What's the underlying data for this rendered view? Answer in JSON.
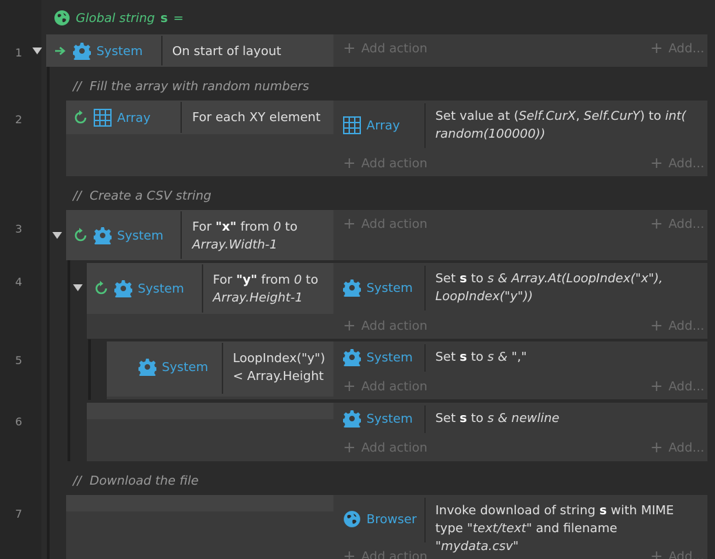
{
  "global": {
    "prefix": "Global string",
    "var": "s",
    "eq": "="
  },
  "add_action": "Add action",
  "add_short": "Add...",
  "comment_marker": "//",
  "lines": [
    "1",
    "2",
    "3",
    "4",
    "5",
    "6",
    "7"
  ],
  "events": {
    "e1": {
      "obj": "System",
      "cond": "On start of layout"
    },
    "c1": "Fill the array with random numbers",
    "e2": {
      "obj": "Array",
      "cond": "For each XY element",
      "act_obj": "Array",
      "act": {
        "p1": "Set value at (",
        "p2": "Self.CurX",
        "p3": ", ",
        "p4": "Self.CurY",
        "p5": ") to ",
        "p6": "int(",
        "p7": "random(100000))"
      }
    },
    "c2": "Create a CSV string",
    "e3": {
      "obj": "System",
      "c_for": "For",
      "c_var": "\"x\"",
      "c_from": "from",
      "c_zero": "0",
      "c_to": "to",
      "c_end": "Array.Width-1"
    },
    "e4": {
      "obj": "System",
      "c_for": "For",
      "c_var": "\"y\"",
      "c_from": "from",
      "c_zero": "0",
      "c_to": "to",
      "c_end": "Array.Height-1",
      "act_obj": "System",
      "act": {
        "p1": "Set",
        "p2": "s",
        "p3": "to",
        "p4": "s & Array.At(LoopIndex(\"x\"),",
        "p5": "LoopIndex(\"y\"))"
      }
    },
    "e5": {
      "obj": "System",
      "cond_l1": "LoopIndex(\"y\")",
      "cond_l2": "< Array.Height",
      "act_obj": "System",
      "act": {
        "p1": "Set",
        "p2": "s",
        "p3": "to",
        "p4": "s &",
        "p5": "\",\""
      }
    },
    "e6": {
      "act_obj": "System",
      "act": {
        "p1": "Set",
        "p2": "s",
        "p3": "to",
        "p4": "s & newline"
      }
    },
    "c3": "Download the file",
    "e7": {
      "act_obj": "Browser",
      "act": {
        "p1": "Invoke download of string",
        "p2": "s",
        "p3": "with MIME",
        "p4": "type",
        "p5": "\"text/text\"",
        "p6": "and filename",
        "p7": "\"mydata.csv\""
      }
    }
  },
  "colors": {
    "accent": "#3fa7e0",
    "green": "#4ec27a",
    "bg": "#2b2b2b",
    "block": "#3a3a3a"
  }
}
